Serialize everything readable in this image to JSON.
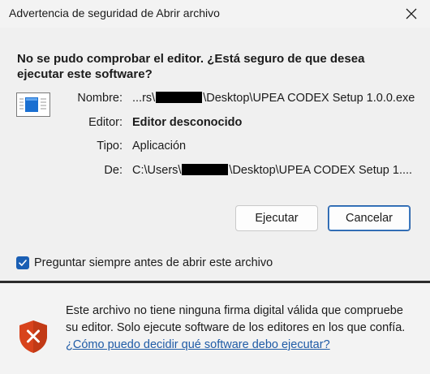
{
  "window": {
    "title": "Advertencia de seguridad de Abrir archivo",
    "close_icon": "close-icon"
  },
  "question": "No se pudo comprobar el editor. ¿Está seguro de que desea ejecutar este software?",
  "details": {
    "name_label": "Nombre:",
    "name_prefix": "...rs\\",
    "name_suffix": "\\Desktop\\UPEA CODEX Setup 1.0.0.exe",
    "publisher_label": "Editor:",
    "publisher_value": "Editor desconocido",
    "type_label": "Tipo:",
    "type_value": "Aplicación",
    "from_label": "De:",
    "from_prefix": "C:\\Users\\",
    "from_suffix": "\\Desktop\\UPEA CODEX Setup 1...."
  },
  "buttons": {
    "run_label": "Ejecutar",
    "cancel_label": "Cancelar"
  },
  "checkbox": {
    "label": "Preguntar siempre antes de abrir este archivo",
    "checked": true
  },
  "footer": {
    "message": "Este archivo no tiene ninguna firma digital válida que compruebe su editor. Solo ejecute software de los editores en los que confía.",
    "link_text": "¿Cómo puedo decidir qué software debo ejecutar?",
    "icon": "shield-warning-icon"
  },
  "colors": {
    "accent": "#1a5fb4",
    "link": "#1f5ba6",
    "shield": "#d8431c"
  }
}
